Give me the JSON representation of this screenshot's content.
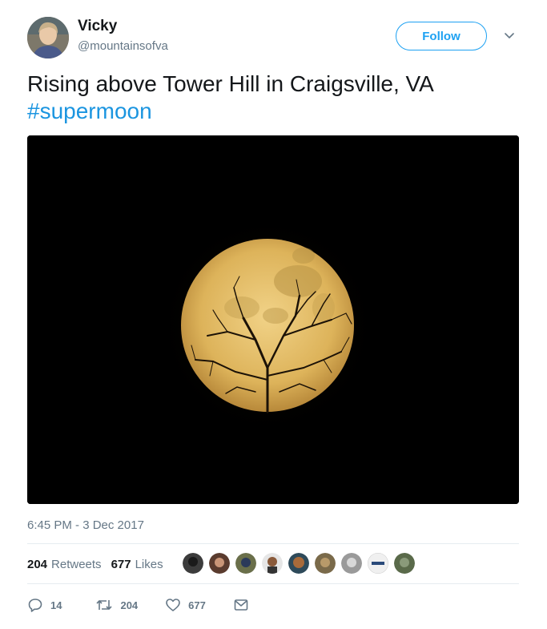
{
  "user": {
    "name": "Vicky",
    "handle": "@mountainsofva",
    "follow_label": "Follow"
  },
  "tweet": {
    "text": "Rising above Tower Hill in Craigsville, VA",
    "hashtag": "#supermoon",
    "timestamp": "6:45 PM - 3 Dec 2017"
  },
  "stats": {
    "retweets_count": "204",
    "retweets_label": "Retweets",
    "likes_count": "677",
    "likes_label": "Likes"
  },
  "actions": {
    "reply_count": "14",
    "retweet_count": "204",
    "like_count": "677"
  },
  "colors": {
    "accent": "#1da1f2",
    "hashtag": "#1b95e0",
    "secondary_text": "#657786",
    "moon": "#e3bb63"
  },
  "likers": [
    "liker-avatar",
    "liker-avatar",
    "liker-avatar",
    "liker-avatar",
    "liker-avatar",
    "liker-avatar",
    "liker-avatar",
    "liker-avatar",
    "liker-avatar"
  ]
}
